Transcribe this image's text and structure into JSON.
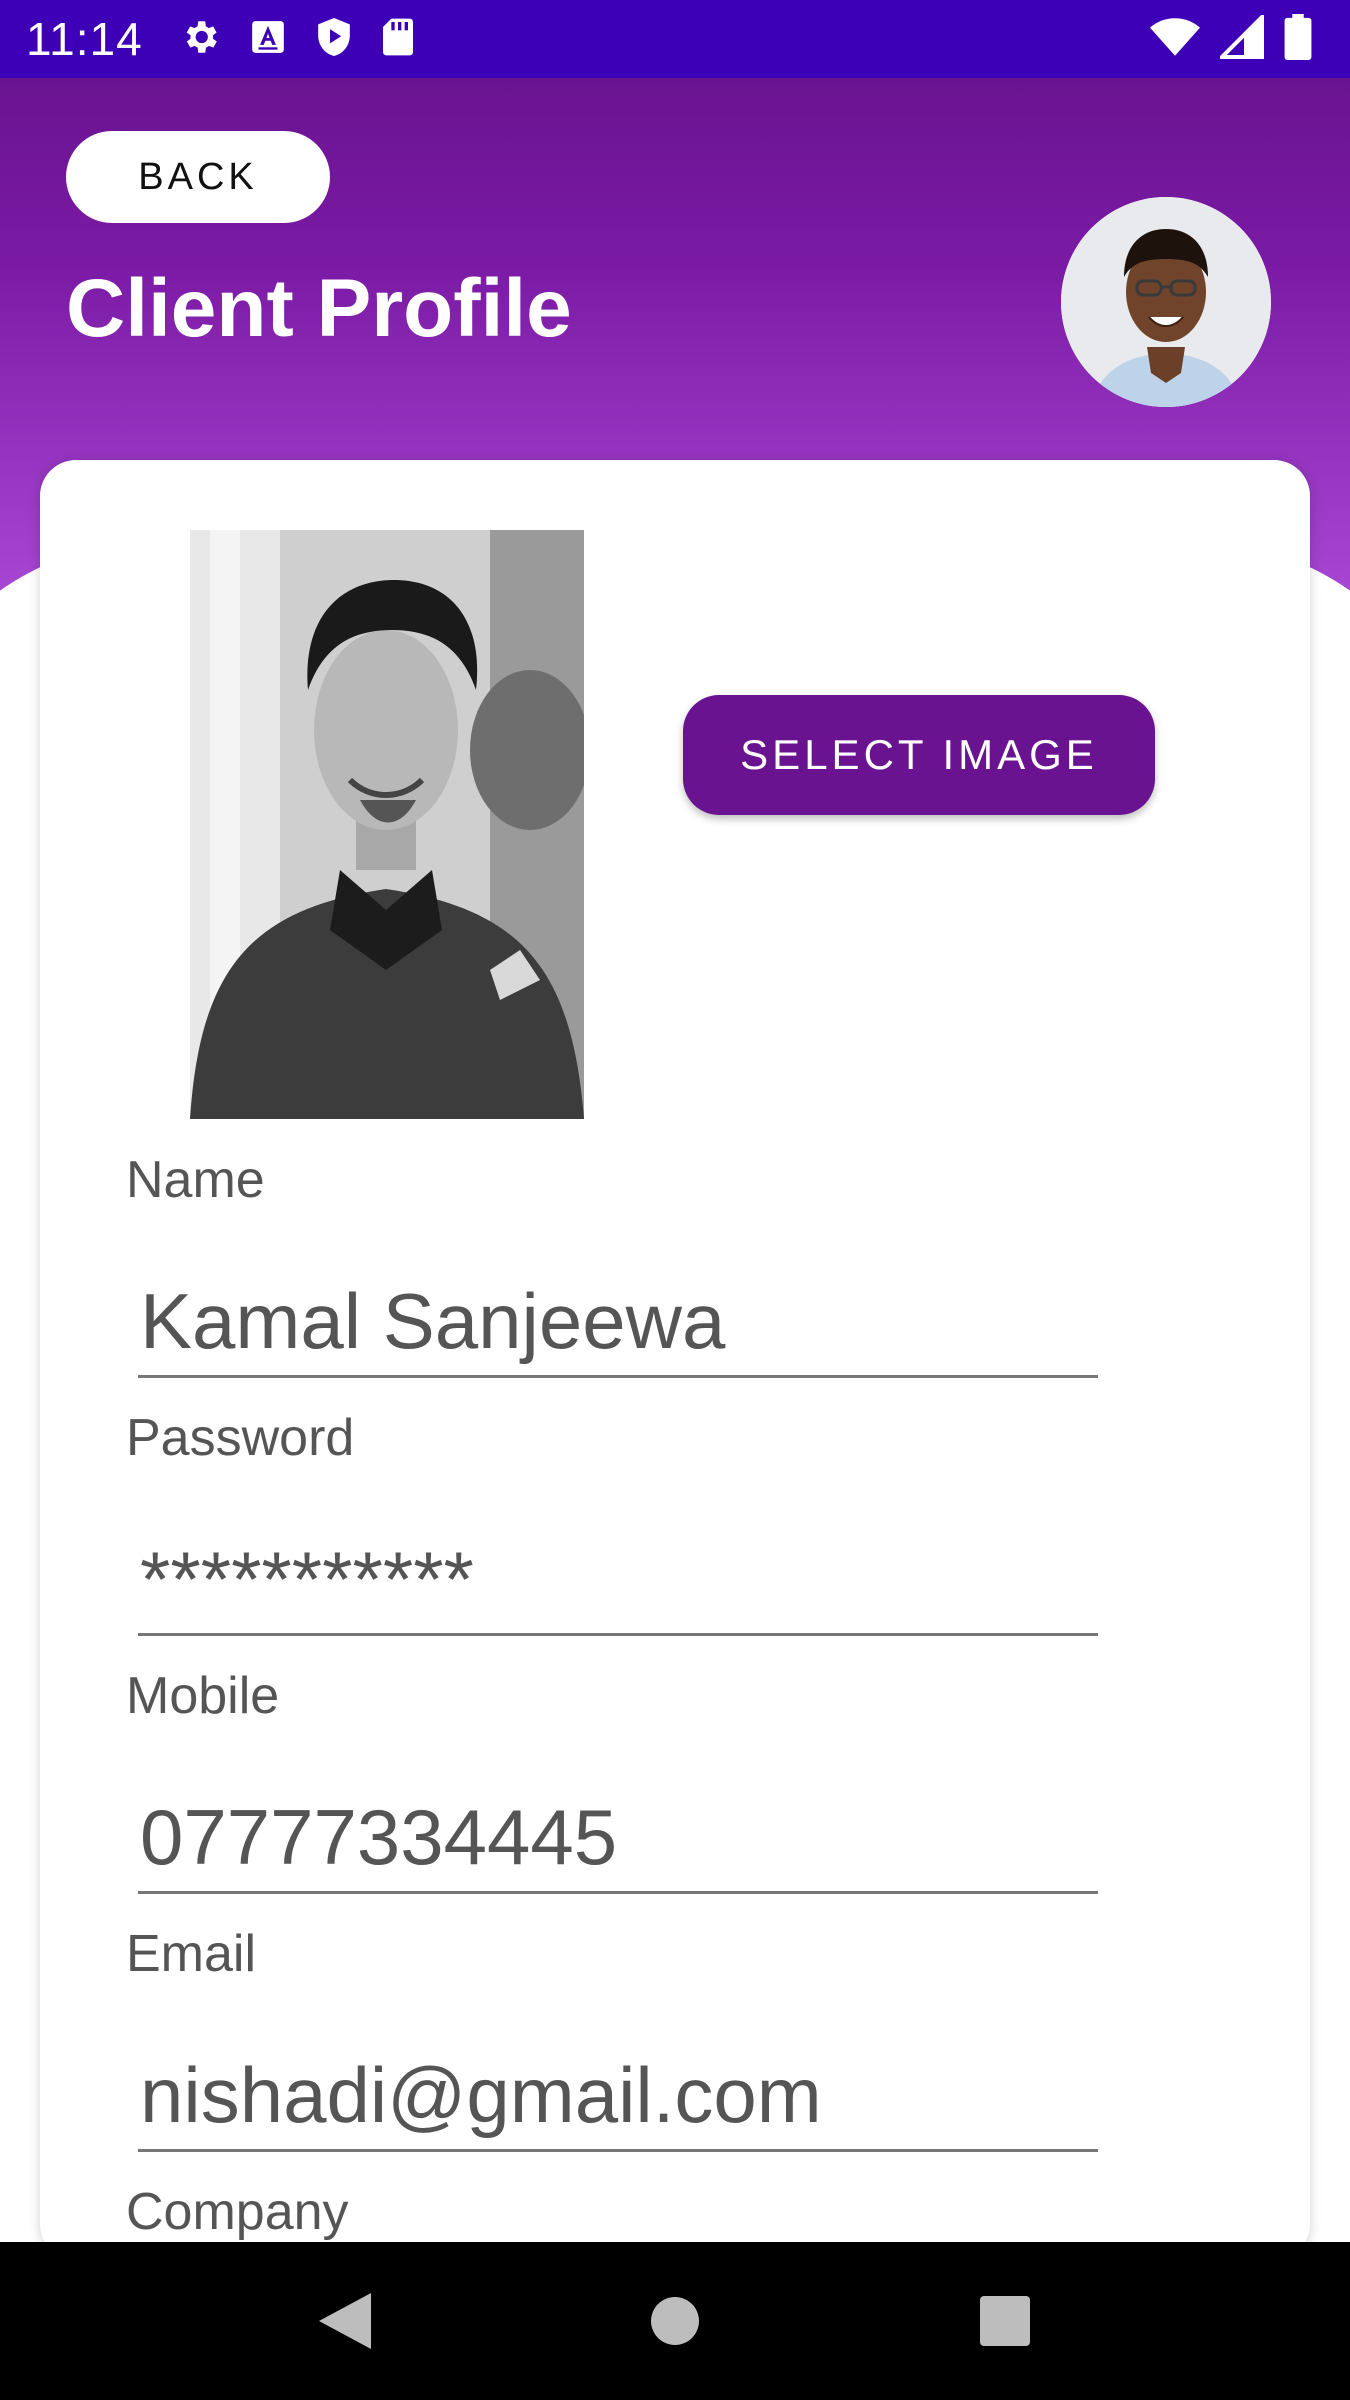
{
  "status_bar": {
    "time": "11:14",
    "left_icons": [
      "gear-icon",
      "a-box-icon",
      "shield-play-icon",
      "sd-card-icon"
    ],
    "right_icons": [
      "wifi-icon",
      "cell-signal-icon",
      "battery-icon"
    ]
  },
  "header": {
    "back_label": "BACK",
    "title": "Client Profile"
  },
  "card": {
    "select_image_label": "SELECT IMAGE",
    "fields": [
      {
        "label": "Name",
        "value": "Kamal Sanjeewa"
      },
      {
        "label": "Password",
        "value": "***********"
      },
      {
        "label": "Mobile",
        "value": "07777334445"
      },
      {
        "label": "Email",
        "value": "nishadi@gmail.com"
      },
      {
        "label": "Company",
        "value": ""
      }
    ]
  },
  "nav_bar": {
    "items": [
      "back-icon",
      "home-icon",
      "recents-icon"
    ]
  },
  "colors": {
    "status_bar": "#3d00b6",
    "header_top": "#6a1391",
    "header_bottom": "#a847d4",
    "accent_button": "#6a1391"
  }
}
